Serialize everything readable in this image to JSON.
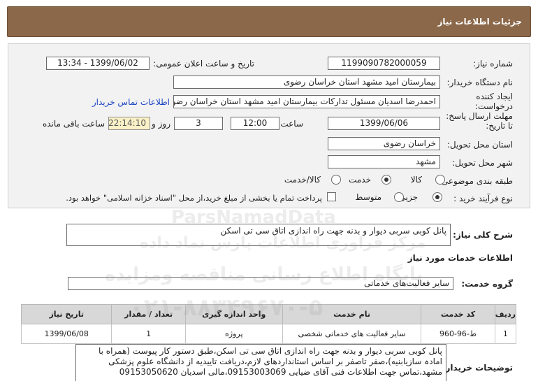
{
  "header": {
    "title": "جزئیات اطلاعات نیاز"
  },
  "form": {
    "need_number_label": "شماره نیاز:",
    "need_number": "1199090782000059",
    "announce_label": "تاریخ و ساعت اعلان عمومی:",
    "announce_value": "1399/06/02 - 13:34",
    "buyer_label": "نام دستگاه خریدار:",
    "buyer_value": "بیمارستان امید مشهد استان خراسان رضوی",
    "creator_label": "ایجاد کننده درخواست:",
    "creator_value": "احمدرضا اسدیان مسئول تدارکات بیمارستان امید مشهد استان خراسان رضوی",
    "contact_link": "اطلاعات تماس خریدار",
    "deadline_label": "مهلت ارسال پاسخ: تا تاریخ:",
    "deadline_date": "1399/06/06",
    "time_label": "ساعت",
    "deadline_time": "12:00",
    "days_value": "3",
    "days_label": "روز و",
    "remaining_time": "22:14:10",
    "remaining_label": "ساعت باقی مانده",
    "province_label": "استان محل تحویل:",
    "province_value": "خراسان رضوی",
    "city_label": "شهر محل تحویل:",
    "city_value": "مشهد",
    "category_label": "طبقه بندی موضوعی:",
    "category_options": [
      "کالا",
      "خدمت",
      "کالا/خدمت"
    ],
    "category_selected": "خدمت",
    "process_label": "نوع فرآیند خرید :",
    "process_options": [
      "جزیی",
      "متوسط"
    ],
    "process_selected": "جزیی",
    "payment_note": "پرداخت تمام یا بخشی از مبلغ خرید،از محل \"اسناد خزانه اسلامی\" خواهد بود."
  },
  "summary": {
    "label": "شرح کلی نیاز:",
    "value": "پانل کوبی سربی دیوار و بدنه جهت راه اندازی اتاق سی تی اسکن"
  },
  "services": {
    "section_title": "اطلاعات خدمات مورد نیاز",
    "group_label": "گروه خدمت:",
    "group_value": "سایر فعالیت‌های خدماتی",
    "table": {
      "headers": [
        "ردیف",
        "کد خدمت",
        "نام خدمت",
        "واحد اندازه گیری",
        "تعداد / مقدار",
        "تاریخ نیاز"
      ],
      "rows": [
        [
          "1",
          "ط-96-960",
          "سایر فعالیت های خدماتی شخصی",
          "پروژه",
          "1",
          "1399/06/08"
        ]
      ]
    }
  },
  "notes": {
    "label": "توضیحات خریدار:",
    "lines": [
      "پانل کوبی سربی دیوار و بدنه جهت راه اندازی اتاق سی تی اسکن،طبق دستور کار پیوست (همراه با",
      "امادہ سازیابنیه)،صفر تاصفر بر اساس استانداردهای لازم،دریافت تاییدیه از دانشگاه علوم پزشکی",
      "مشهد،تماس جهت اطلاعات فنی آقای ضیایی 09153003069،مالی اسدیان 09153050620"
    ]
  },
  "watermark": {
    "brand": "ParsNamadData",
    "line1": "مرکز فراوری اطلاعات پارس نماد داده",
    "line2": "پایگاه اطلاع رسانی مناقصه ومزایده",
    "phone": "۰۲۱-۸۸۳۴۹۶۷۰-۵"
  }
}
